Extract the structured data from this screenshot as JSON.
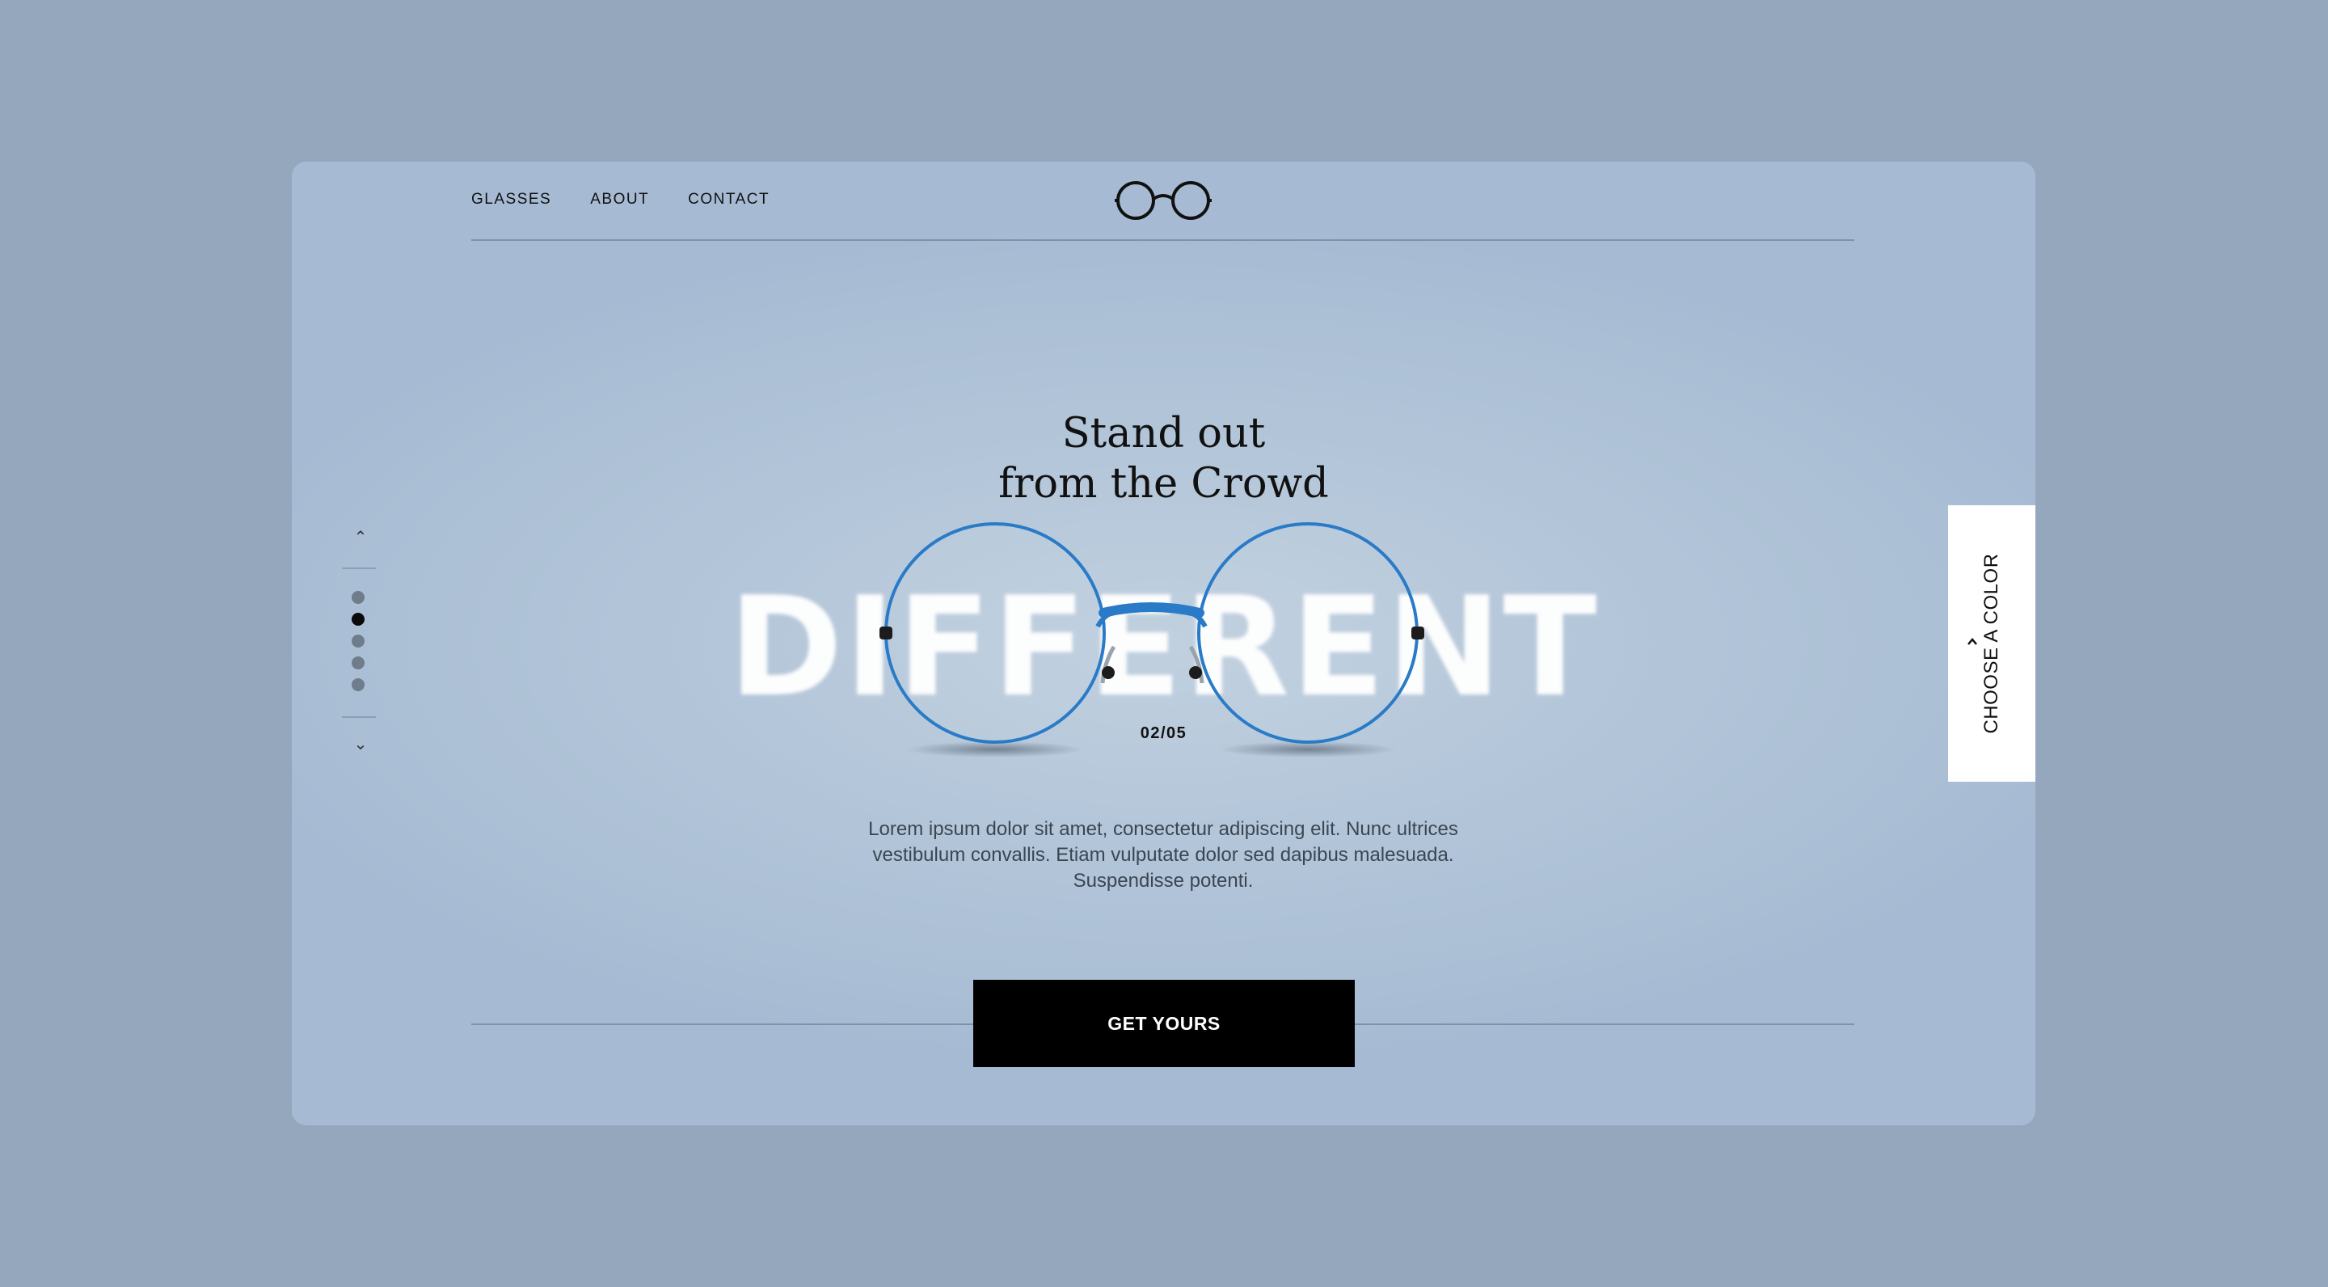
{
  "nav": {
    "items": [
      {
        "label": "GLASSES"
      },
      {
        "label": "ABOUT"
      },
      {
        "label": "CONTACT"
      }
    ]
  },
  "logo": {
    "icon": "glasses-logo-icon"
  },
  "pager": {
    "up_icon": "chevron-up-icon",
    "down_icon": "chevron-down-icon",
    "total": 5,
    "active_index": 1,
    "up_glyph": "⌃",
    "down_glyph": "⌄"
  },
  "hero": {
    "headline_line1": "Stand out",
    "headline_line2": "from the Crowd",
    "big_word": "DIFFERENT",
    "counter": "02/05",
    "description": "Lorem ipsum dolor sit amet, consectetur adipiscing elit. Nunc ultrices vestibulum convallis. Etiam vulputate dolor sed dapibus malesuada. Suspendisse potenti.",
    "cta_label": "GET YOURS",
    "product_color": "#2a7bc7"
  },
  "color_tab": {
    "label": "CHOOSE A COLOR",
    "icon": "chevron-left-icon"
  },
  "colors": {
    "page_bg": "#95a7bd",
    "card_bg": "#b4c6d9",
    "cta_bg": "#000000"
  }
}
